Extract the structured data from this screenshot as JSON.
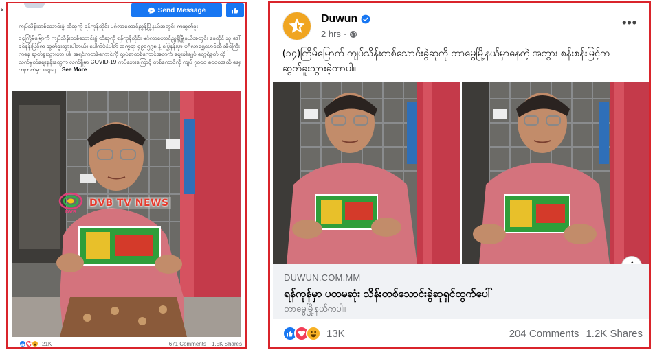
{
  "corner_label": "s",
  "left_post": {
    "send_message_label": "Send Message",
    "caption_line1": "ကျပ်သိန်းတစ်သောင်းခွဲ ထီဆုကို ရန်ကုန်တိုင်း မင်္ဂလာတောင်ညွန့်မြို့နယ်အတွင်း ကဆွတ်ခူး",
    "caption_body": "၁၄ကြိမ်မြောက် ကျပ်သိန်းတစ်သောင်းခွဲ ထီဆုကို ရန်ကုန်တိုင်း မင်္ဂလာတောင်ညွန့်မြို့နယ်အတွင်း နေထိုင် သူ ဒေါ်ခင်နန်းမြင့်က ဆွတ်ခူးသွားပါတယ်။ ပေါက်မဲနံပါတ် အက္ခရာ ၄၉၁၅၇၈ နဲ့ မြွေနန်းမှာ မင်္ဂလာရွှေမောင်ထီ ဆိုင်ကြီးကနေ ဆွတ်ခူးသွားတာ ပါ။ အရင်ကတစ်ကောင်ကို လွှပ်စာတစ်ကောင်အတက် ဈေးခါးချုပ် တွေရဲ့စုတ် ထိုလက်မှတ်ဈေးနန်းတွေက လက်ရှိမှာ COVID-19 ကပ်ဘေးကြောင့် တစ်ကောင်ကို ကျပ် ၇၀၀၀ ၈၀၀၀အထိ ဈေးကျတက်မှာ ဈေးချ...",
    "see_more": "See More",
    "watermark": "DVB TV NEWS",
    "watermark_small": "DVB",
    "reaction_count": "21K",
    "comments": "671 Comments",
    "shares": "1.5K Shares"
  },
  "right_post": {
    "page_name": "Duwun",
    "time": "2 hrs",
    "more_label": "•••",
    "caption": "(၁၄)ကြိမ်မြောက် ကျပ်သိန်းတစ်သောင်းခွဲဆုကို တာမွေမြို့နယ်မှာနေတဲ့ အဘွား စန်းစန်းမြင့်က ဆွတ်ခူးသွားခဲ့တာပါ။",
    "link_domain": "DUWUN.COM.MM",
    "link_title": "ရန်ကုန်မှာ ပထမဆုံး သိန်းတစ်သောင်းခွဲဆုရှင်ထွက်ပေါ်",
    "link_subtitle": "တာမွေမြို့နယ်ကပါ။",
    "reaction_count": "13K",
    "comments": "204 Comments",
    "shares": "1.2K Shares"
  },
  "colors": {
    "frame_red": "#d9242b",
    "facebook_blue": "#1877f2",
    "duwun_orange": "#f0a521",
    "love_red": "#f33e58",
    "haha_yellow": "#f7b125"
  },
  "icons": [
    "messenger-icon",
    "thumbs-up-icon",
    "verified-badge-icon",
    "globe-icon",
    "info-icon",
    "like-reaction-icon",
    "love-reaction-icon",
    "haha-reaction-icon"
  ]
}
